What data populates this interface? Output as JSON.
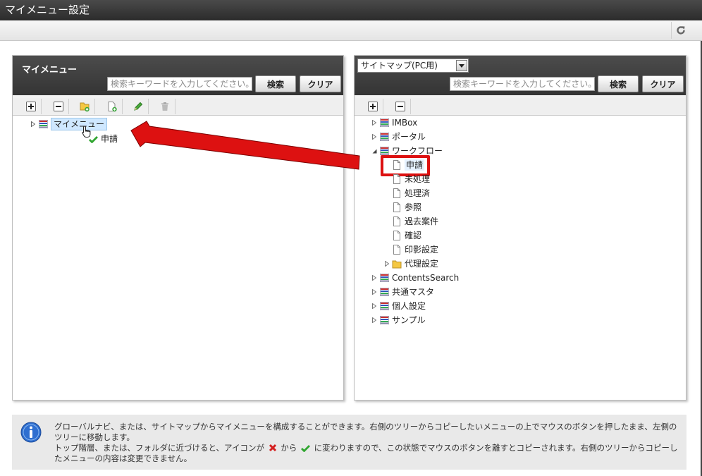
{
  "window": {
    "title": "マイメニュー設定"
  },
  "toolbar": {
    "refresh_icon": "refresh-icon"
  },
  "left_panel": {
    "title": "マイメニュー",
    "search": {
      "placeholder": "検索キーワードを入力してください。",
      "value": ""
    },
    "search_button": "検索",
    "clear_button": "クリア",
    "tree_toolbar": [
      "plus-icon",
      "minus-icon",
      "folder-add-icon",
      "page-add-icon",
      "pencil-icon",
      "trash-icon"
    ],
    "tree": {
      "root": {
        "label": "マイメニュー",
        "icon": "menu-list-icon",
        "selected": true
      },
      "drag_item": {
        "label": "申請",
        "icon": "check-icon"
      }
    }
  },
  "right_panel": {
    "select": {
      "value": "サイトマップ(PC用)"
    },
    "search": {
      "placeholder": "検索キーワードを入力してください。",
      "value": ""
    },
    "search_button": "検索",
    "clear_button": "クリア",
    "tree_toolbar": [
      "plus-icon",
      "minus-icon"
    ],
    "tree": [
      {
        "label": "IMBox",
        "icon": "menu-list-icon",
        "level": 0,
        "state": "collapsed"
      },
      {
        "label": "ポータル",
        "icon": "menu-list-icon",
        "level": 0,
        "state": "collapsed"
      },
      {
        "label": "ワークフロー",
        "icon": "menu-list-icon",
        "level": 0,
        "state": "expanded"
      },
      {
        "label": "申請",
        "icon": "page-icon",
        "level": 1,
        "state": "leaf",
        "highlighted": true
      },
      {
        "label": "未処理",
        "icon": "page-icon",
        "level": 1,
        "state": "leaf"
      },
      {
        "label": "処理済",
        "icon": "page-icon",
        "level": 1,
        "state": "leaf"
      },
      {
        "label": "参照",
        "icon": "page-icon",
        "level": 1,
        "state": "leaf"
      },
      {
        "label": "過去案件",
        "icon": "page-icon",
        "level": 1,
        "state": "leaf"
      },
      {
        "label": "確認",
        "icon": "page-icon",
        "level": 1,
        "state": "leaf"
      },
      {
        "label": "印影設定",
        "icon": "page-icon",
        "level": 1,
        "state": "leaf"
      },
      {
        "label": "代理設定",
        "icon": "folder-icon",
        "level": 1,
        "state": "collapsed"
      },
      {
        "label": "ContentsSearch",
        "icon": "menu-list-icon",
        "level": 0,
        "state": "collapsed"
      },
      {
        "label": "共通マスタ",
        "icon": "menu-list-icon",
        "level": 0,
        "state": "collapsed"
      },
      {
        "label": "個人設定",
        "icon": "menu-list-icon",
        "level": 0,
        "state": "collapsed"
      },
      {
        "label": "サンプル",
        "icon": "menu-list-icon",
        "level": 0,
        "state": "collapsed"
      }
    ]
  },
  "info": {
    "icon": "info-icon",
    "line1": "グローバルナビ、または、サイトマップからマイメニューを構成することができます。右側のツリーからコピーしたいメニューの上でマウスのボタンを押したまま、左側のツリーに移動します。",
    "line2_a": "トップ階層、または、フォルダに近づけると、アイコンが",
    "line2_b": "から",
    "line2_c": "に変わりますので、この状態でマウスのボタンを離すとコピーされます。右側のツリーからコピーしたメニューの内容は変更できません。"
  },
  "colors": {
    "header_dark": "#3a3a3a",
    "highlight_red": "#dd1111",
    "selection": "#cfe8ff",
    "check_green": "#2fa52f"
  }
}
